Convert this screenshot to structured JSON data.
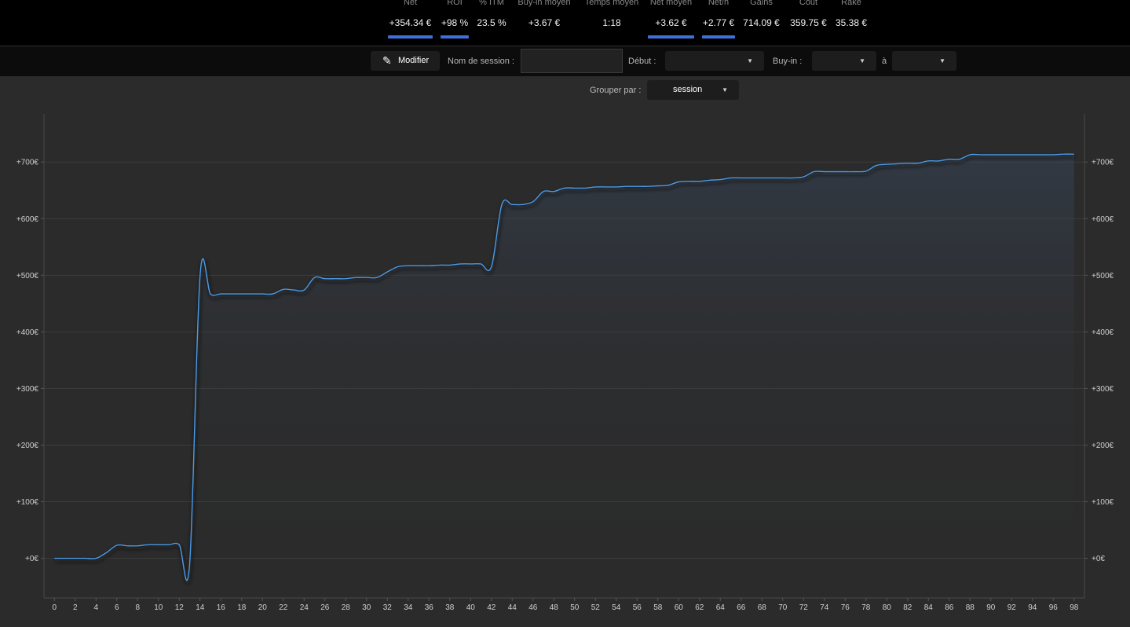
{
  "stats": [
    {
      "label": "Net",
      "value": "+354.34 €",
      "highlight": true
    },
    {
      "label": "ROI",
      "value": "+98 %",
      "highlight": true
    },
    {
      "label": "% ITM",
      "value": "23.5 %",
      "highlight": false
    },
    {
      "label": "Buy-in moyen",
      "value": "+3.67 €",
      "highlight": false
    },
    {
      "label": "Temps moyen",
      "value": "1:18",
      "highlight": false
    },
    {
      "label": "Net moyen",
      "value": "+3.62 €",
      "highlight": true
    },
    {
      "label": "Net/h",
      "value": "+2.77 €",
      "highlight": true
    },
    {
      "label": "Gains",
      "value": "714.09 €",
      "highlight": false
    },
    {
      "label": "Cout",
      "value": "359.75 €",
      "highlight": false
    },
    {
      "label": "Rake",
      "value": "35.38 €",
      "highlight": false
    }
  ],
  "filters": {
    "edit_label": "Modifier",
    "session_name_label": "Nom de session :",
    "session_name_value": "",
    "start_label": "Début :",
    "start_value": "",
    "buyin_label": "Buy-in :",
    "buyin_min_value": "",
    "to_label": "à",
    "buyin_max_value": "",
    "group_by_label": "Grouper par :",
    "group_by_value": "session"
  },
  "colors": {
    "accent": "#3f6fd8",
    "line": "#4a9ae6",
    "background": "#2b2b2b"
  },
  "chart_data": {
    "type": "line",
    "title": "",
    "xlabel": "",
    "ylabel": "",
    "xlim": [
      -1,
      99
    ],
    "ylim": [
      -70,
      785
    ],
    "grid": true,
    "y_ticks": [
      0,
      100,
      200,
      300,
      400,
      500,
      600,
      700
    ],
    "y_tick_labels": [
      "+0€",
      "+100€",
      "+200€",
      "+300€",
      "+400€",
      "+500€",
      "+600€",
      "+700€"
    ],
    "x_ticks": [
      0,
      2,
      4,
      6,
      8,
      10,
      12,
      14,
      16,
      18,
      20,
      22,
      24,
      26,
      28,
      30,
      32,
      34,
      36,
      38,
      40,
      42,
      44,
      46,
      48,
      50,
      52,
      54,
      56,
      58,
      60,
      62,
      64,
      66,
      68,
      70,
      72,
      74,
      76,
      78,
      80,
      82,
      84,
      86,
      88,
      90,
      92,
      94,
      96,
      98
    ],
    "series": [
      {
        "x": [
          0,
          1,
          2,
          3,
          4,
          5,
          6,
          7,
          8,
          9,
          10,
          11,
          12,
          13,
          14,
          15,
          16,
          17,
          18,
          19,
          20,
          21,
          22,
          23,
          24,
          25,
          26,
          27,
          28,
          29,
          30,
          31,
          32,
          33,
          34,
          35,
          36,
          37,
          38,
          39,
          40,
          41,
          42,
          43,
          44,
          45,
          46,
          47,
          48,
          49,
          50,
          51,
          52,
          53,
          54,
          55,
          56,
          57,
          58,
          59,
          60,
          61,
          62,
          63,
          64,
          65,
          66,
          67,
          68,
          69,
          70,
          71,
          72,
          73,
          74,
          75,
          76,
          77,
          78,
          79,
          80,
          81,
          82,
          83,
          84,
          85,
          86,
          87,
          88,
          89,
          90,
          91,
          92,
          93,
          94,
          95,
          96,
          97,
          98
        ],
        "y": [
          0,
          0,
          0,
          0,
          0,
          10,
          23,
          22,
          22,
          24,
          24,
          24,
          24,
          -10,
          500,
          467,
          467,
          467,
          467,
          467,
          467,
          467,
          475,
          474,
          474,
          496,
          494,
          494,
          494,
          496,
          496,
          496,
          506,
          515,
          517,
          517,
          517,
          518,
          518,
          520,
          520,
          520,
          515,
          625,
          625,
          625,
          630,
          648,
          648,
          654,
          654,
          654,
          656,
          656,
          656,
          657,
          657,
          657,
          658,
          659,
          665,
          666,
          666,
          668,
          669,
          672,
          672,
          672,
          672,
          672,
          672,
          672,
          674,
          683,
          683,
          683,
          683,
          683,
          684,
          694,
          696,
          697,
          698,
          698,
          702,
          702,
          705,
          705,
          713,
          713,
          713,
          713,
          713,
          713,
          713,
          713,
          713,
          714,
          714
        ]
      }
    ]
  }
}
